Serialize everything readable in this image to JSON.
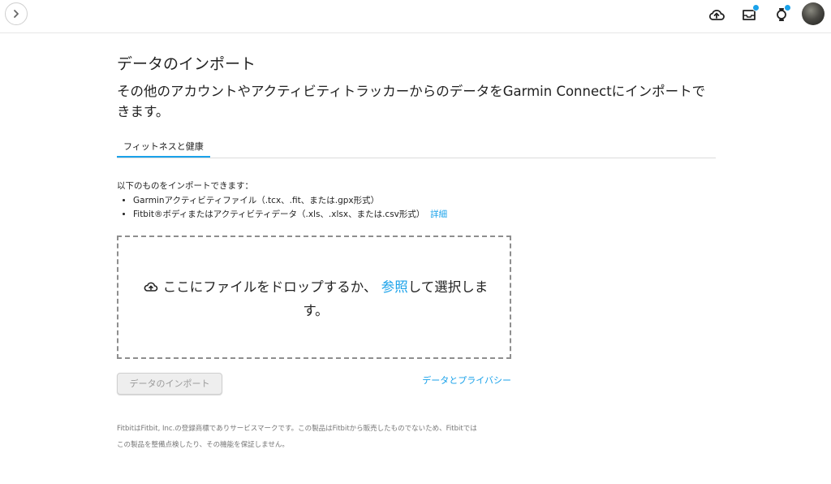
{
  "topbar": {
    "icons": [
      "chevron-right-icon",
      "upload-cloud-icon",
      "inbox-icon",
      "watch-icon",
      "avatar"
    ],
    "notification_color": "#1aa2ea"
  },
  "page": {
    "title": "データのインポート",
    "subtitle": "その他のアカウントやアクティビティトラッカーからのデータをGarmin Connectにインポートできます。"
  },
  "tabs": [
    {
      "label": "フィットネスと健康",
      "active": true
    }
  ],
  "info": {
    "lead": "以下のものをインポートできます：",
    "items": [
      "Garminアクティビティファイル（.tcx、.fit、または.gpx形式）",
      "Fitbit®ボディまたはアクティビティデータ（.xls、.xlsx、または.csv形式）"
    ],
    "details_link": "詳細"
  },
  "dropzone": {
    "text_before": "ここにファイルをドロップするか、",
    "browse_link": "参照",
    "text_after": "して選択します。"
  },
  "actions": {
    "import_button": "データのインポート",
    "privacy_link": "データとプライバシー"
  },
  "footer": {
    "line1": "FitbitはFitbit, Inc.の登録商標でありサービスマークです。この製品はFitbitから販売したものでないため、Fitbitでは",
    "line2": "この製品を整備点検したり、その機能を保証しません。"
  },
  "colors": {
    "accent": "#1aa2ea",
    "text": "#222222",
    "muted": "#777777"
  }
}
